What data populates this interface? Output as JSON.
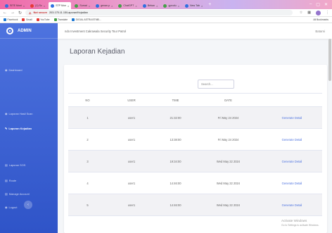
{
  "browser": {
    "tabs": [
      {
        "label": "SITE Moni",
        "fav": "blue"
      },
      {
        "label": "(1) Sc",
        "fav": "red"
      },
      {
        "label": "STP Mon",
        "fav": "blue",
        "active": true
      },
      {
        "label": "Sumat",
        "fav": "green"
      },
      {
        "label": "genan.p",
        "fav": "blue"
      },
      {
        "label": "ChatGPT",
        "fav": "green"
      },
      {
        "label": "Beban",
        "fav": "blue"
      },
      {
        "label": "gprodu",
        "fav": "green"
      },
      {
        "label": "New Tab",
        "fav": "blue"
      }
    ],
    "new_tab_glyph": "+",
    "security_label": "Not secure",
    "url": "203.175.11.15/Laporan/Kejadian",
    "bookmarks": [
      {
        "label": "Facebook",
        "color": "b"
      },
      {
        "label": "Gmail",
        "color": "r"
      },
      {
        "label": "YouTube",
        "color": "r"
      },
      {
        "label": "Translate",
        "color": "g"
      },
      {
        "label": "DIGIAL ASTRA BTMB...",
        "color": "b"
      }
    ],
    "bookmarks_right": "All Bookmarks"
  },
  "sidebar": {
    "brand": "ADMIN",
    "items": [
      {
        "label": "Dashboard",
        "icon": "dashboard-icon",
        "glyph": "◉",
        "active": false
      },
      {
        "label": "Laporan Hasil Scan",
        "icon": "scan-icon",
        "glyph": "◉",
        "active": false
      },
      {
        "label": "Laporan Kejadian",
        "icon": "pen-icon",
        "glyph": "✎",
        "active": true
      },
      {
        "label": "Laporan SOS",
        "icon": "sos-icon",
        "glyph": "▤",
        "active": false
      },
      {
        "label": "Route",
        "icon": "route-icon",
        "glyph": "▤",
        "active": false
      },
      {
        "label": "Manage Account",
        "icon": "account-icon",
        "glyph": "▤",
        "active": false
      },
      {
        "label": "Logout",
        "icon": "logout-icon",
        "glyph": "◉",
        "active": false
      }
    ],
    "toggle_glyph": "‹"
  },
  "topbar": {
    "title": "ndo Investment Cakrawala Security Tour Patrol",
    "user": "Batami"
  },
  "main": {
    "page_title": "Laporan Kejadian",
    "search_placeholder": "Search...",
    "columns": [
      "NO",
      "USER",
      "TIME",
      "DATE",
      ""
    ],
    "action_label": "Generate Detail",
    "rows": [
      {
        "no": "1",
        "user": "user1",
        "time": "21:32:00",
        "date": "Fri May 24 2024"
      },
      {
        "no": "2",
        "user": "user1",
        "time": "13:38:00",
        "date": "Fri May 24 2024"
      },
      {
        "no": "3",
        "user": "user1",
        "time": "19:34:00",
        "date": "Wed May 22 2024"
      },
      {
        "no": "4",
        "user": "user1",
        "time": "14:46:00",
        "date": "Wed May 22 2024"
      },
      {
        "no": "5",
        "user": "user1",
        "time": "14:46:00",
        "date": "Wed May 22 2024"
      }
    ]
  },
  "watermark": {
    "line1": "Activate Windows",
    "line2": "Go to Settings to activate Windows."
  },
  "colors": {
    "sidebar": "#4e73df",
    "link": "#4e73df"
  }
}
